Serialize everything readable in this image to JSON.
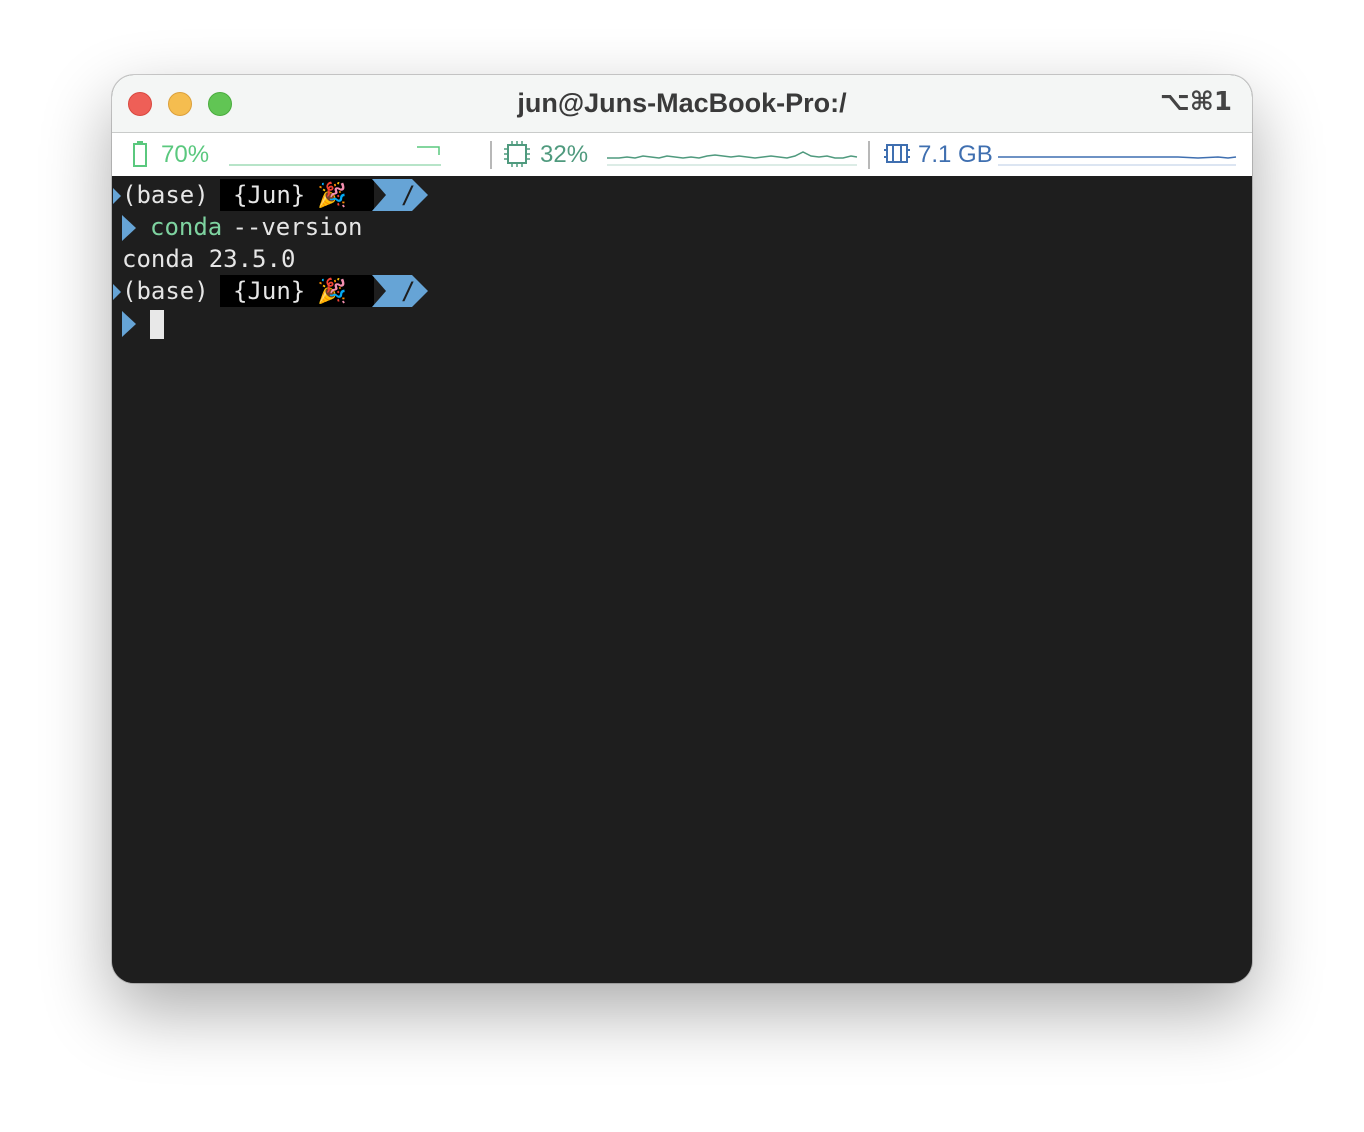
{
  "window": {
    "title": "jun@Juns-MacBook-Pro:/",
    "shortcut": "⌥⌘1"
  },
  "status": {
    "battery": {
      "label": "70%",
      "color": "#5ac87e",
      "icon": "battery-icon"
    },
    "cpu": {
      "label": "32%",
      "color": "#4f9a7e",
      "icon": "cpu-icon"
    },
    "memory": {
      "label": "7.1 GB",
      "color": "#3f6fb0",
      "icon": "memory-icon"
    }
  },
  "terminal": {
    "prompt": {
      "env": "(base)",
      "user": "{Jun}",
      "emoji": "🎉",
      "path": "/",
      "path_color": "#66a4d6",
      "arrow_color": "#66a4d6"
    },
    "command": {
      "name": "conda",
      "args": " --version",
      "name_color": "#7ed3a0"
    },
    "output": "conda 23.5.0"
  }
}
